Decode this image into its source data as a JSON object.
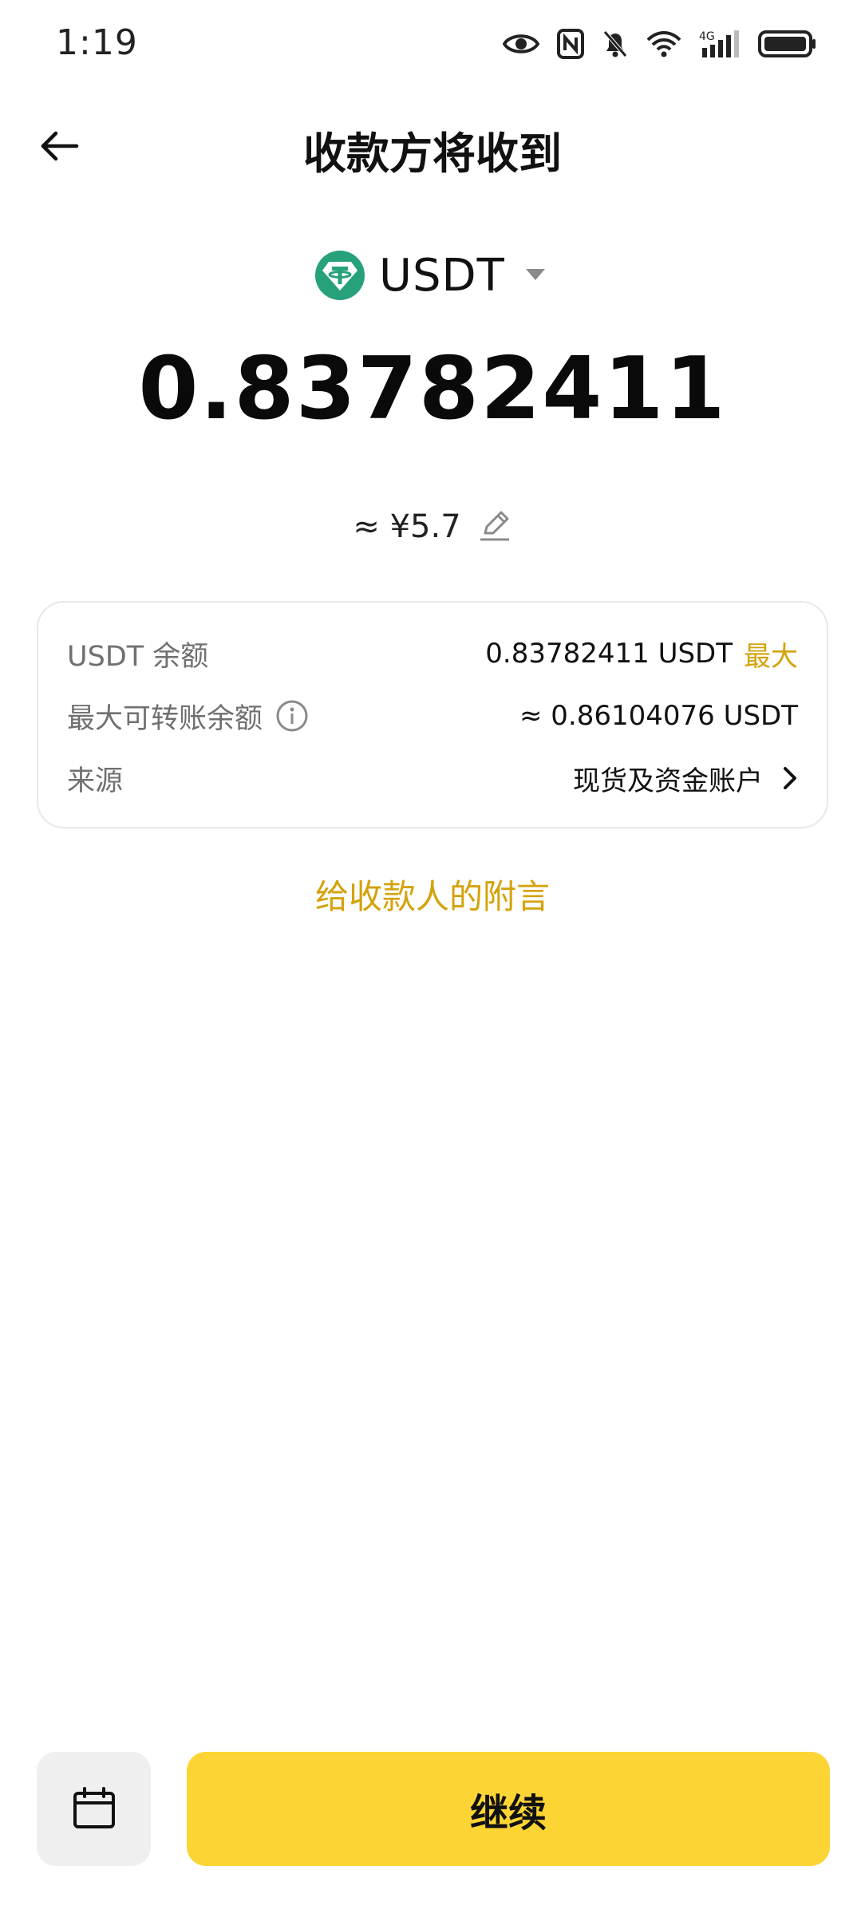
{
  "status_bar": {
    "time": "1:19",
    "network_label": "4G",
    "icons": [
      "eye-icon",
      "nfc-icon",
      "mute-bell-icon",
      "wifi-icon",
      "signal-icon",
      "battery-icon"
    ]
  },
  "header": {
    "title": "收款方将收到",
    "back_icon": "arrow-left-icon"
  },
  "currency": {
    "symbol": "USDT",
    "icon": "tether-coin-icon",
    "brand_color": "#26A17B"
  },
  "amount": {
    "value": "0.83782411"
  },
  "fiat": {
    "approx_value": "≈ ¥5.7",
    "edit_icon": "pencil-icon"
  },
  "info_card": {
    "balance": {
      "label": "USDT 余额",
      "value": "0.83782411 USDT",
      "max_label": "最大"
    },
    "max_transferable": {
      "label": "最大可转账余额",
      "value": "≈ 0.86104076 USDT",
      "info_icon": "info-circle-icon"
    },
    "source": {
      "label": "来源",
      "value": "现货及资金账户",
      "chevron_icon": "chevron-right-icon"
    }
  },
  "note_link": "给收款人的附言",
  "bottom": {
    "schedule_icon": "calendar-icon",
    "continue_label": "继续"
  },
  "colors": {
    "accent": "#D4A20A",
    "primary_button": "#FCD535",
    "secondary_button": "#EFEFEF"
  }
}
